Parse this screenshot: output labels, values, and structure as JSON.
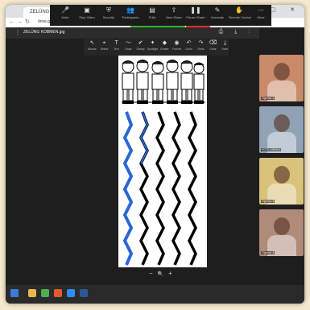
{
  "browser": {
    "tab_title": "ZELÜNG KOBMEN.jpg",
    "url": "drive.google.com/file/d/1y",
    "new_tab": "+",
    "window_controls": "– ▢ ✕"
  },
  "zoom_toolbar": {
    "buttons": [
      {
        "label": "Mute",
        "icon": "microphone-icon",
        "glyph": "🎤"
      },
      {
        "label": "Stop Video",
        "icon": "video-icon",
        "glyph": "▣"
      },
      {
        "label": "Security",
        "icon": "shield-icon",
        "glyph": "⛨"
      },
      {
        "label": "Participants",
        "icon": "participants-icon",
        "glyph": "👥"
      },
      {
        "label": "Polls",
        "icon": "polls-icon",
        "glyph": "▤"
      },
      {
        "label": "New Share",
        "icon": "share-icon",
        "glyph": "⇧"
      },
      {
        "label": "Pause Share",
        "icon": "pause-icon",
        "glyph": "❚❚"
      },
      {
        "label": "Annotate",
        "icon": "annotate-icon",
        "glyph": "✎"
      },
      {
        "label": "Remote Control",
        "icon": "remote-control-icon",
        "glyph": "✋"
      },
      {
        "label": "More",
        "icon": "more-icon",
        "glyph": "⋯"
      }
    ],
    "sharing_banner": "You are screen sharing",
    "stop_share": "Stop Share",
    "accent": "#2eb82e",
    "stop_color": "#d9342b"
  },
  "pdf_viewer": {
    "file_name": "ZELÜNG KOBMEN.jpg",
    "menu": "⋮",
    "right_icons": "⎙ ⤓ ⋮"
  },
  "annotation_toolbar": {
    "tools": [
      {
        "label": "Mouse",
        "icon": "mouse-icon",
        "glyph": "↖"
      },
      {
        "label": "Select",
        "icon": "select-icon",
        "glyph": "⌖"
      },
      {
        "label": "Text",
        "icon": "text-icon",
        "glyph": "T"
      },
      {
        "label": "Draw",
        "icon": "draw-icon",
        "glyph": "〜"
      },
      {
        "label": "Stamp",
        "icon": "stamp-icon",
        "glyph": "✔"
      },
      {
        "label": "Spotlight",
        "icon": "spotlight-icon",
        "glyph": "✦"
      },
      {
        "label": "Eraser",
        "icon": "eraser-icon",
        "glyph": "◆"
      },
      {
        "label": "Format",
        "icon": "format-icon",
        "glyph": "◉"
      },
      {
        "label": "Undo",
        "icon": "undo-icon",
        "glyph": "↶"
      },
      {
        "label": "Redo",
        "icon": "redo-icon",
        "glyph": "↷"
      },
      {
        "label": "Clear",
        "icon": "clear-icon",
        "glyph": "⌫"
      },
      {
        "label": "Save",
        "icon": "save-icon",
        "glyph": "⤓"
      }
    ],
    "active_tool": "Draw"
  },
  "page_zoom": {
    "minus": "−",
    "zoom_icon": "🔍",
    "plus": "+"
  },
  "gallery": {
    "participants": [
      {
        "name": "Öğrenci 1",
        "bg": "#c98a6a"
      },
      {
        "name": "FOTO KIRMIZI",
        "bg": "#8fa3b5"
      },
      {
        "name": "Öğrenci 3",
        "bg": "#d9c27a"
      },
      {
        "name": "Öğrenci 4",
        "bg": "#b08b7a"
      }
    ]
  },
  "taskbar": {
    "icons": [
      {
        "name": "folder-icon",
        "color": "#e8b84a"
      },
      {
        "name": "chrome-icon",
        "color": "#4caf50"
      },
      {
        "name": "media-icon",
        "color": "#e05a2b"
      },
      {
        "name": "zoom-icon",
        "color": "#2d8cff"
      },
      {
        "name": "word-icon",
        "color": "#2b5797"
      }
    ]
  }
}
